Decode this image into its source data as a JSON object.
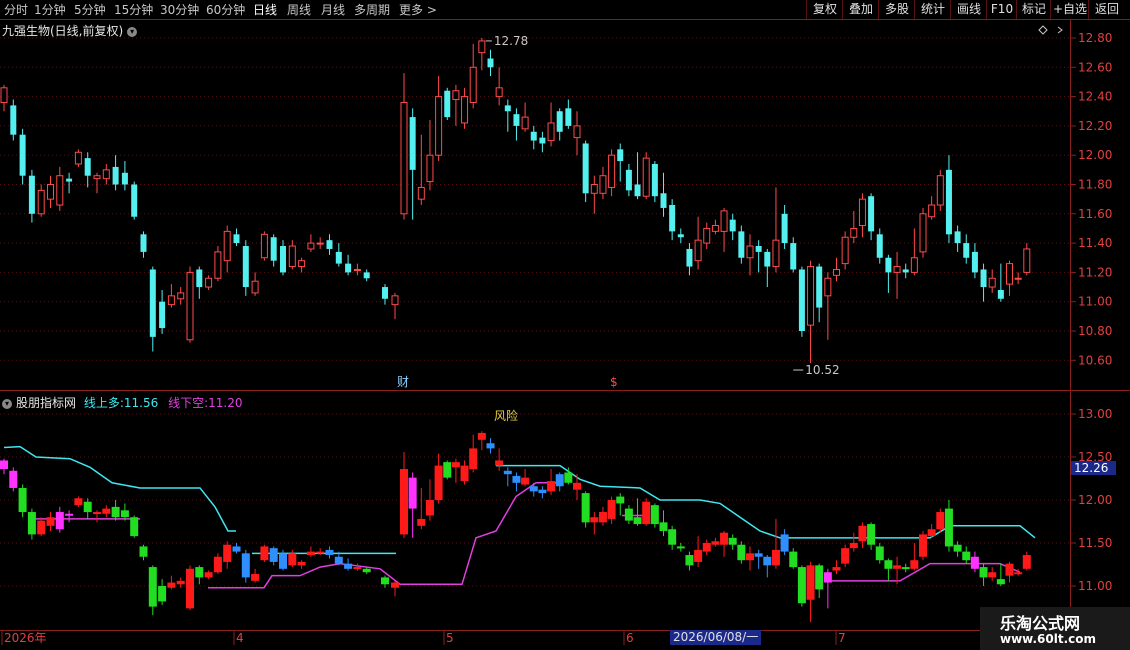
{
  "toolbar": {
    "tabs": [
      "分时",
      "1分钟",
      "5分钟",
      "15分钟",
      "30分钟",
      "60分钟",
      "日线",
      "周线",
      "月线",
      "多周期",
      "更多 >"
    ],
    "active_tab": "日线",
    "right_buttons": [
      "复权",
      "叠加",
      "多股",
      "统计",
      "画线",
      "F10",
      "标记",
      "+自选",
      "返回"
    ]
  },
  "main_chart": {
    "title": "九强生物(日线,前复权)",
    "high_label": "12.78",
    "low_label": "10.52",
    "markers": [
      "财",
      "$"
    ],
    "price_axis": [
      "12.80",
      "12.60",
      "12.40",
      "12.20",
      "12.00",
      "11.80",
      "11.60",
      "11.40",
      "11.20",
      "11.00",
      "10.80",
      "10.60"
    ]
  },
  "indicator": {
    "name": "股朋指标网",
    "line_up_label": "线上多:",
    "line_up_value": "11.56",
    "line_down_label": "线下空:",
    "line_down_value": "11.20",
    "risk_text": "风险",
    "axis": [
      "13.00",
      "12.50",
      "12.00",
      "11.50",
      "11.00"
    ],
    "current_value": "12.26"
  },
  "x_axis": {
    "labels": [
      "2026年",
      "4",
      "5",
      "6",
      "7"
    ],
    "highlight_date": "2026/06/08/一"
  },
  "watermark": {
    "line1": "乐淘公式网",
    "line2": "www.60lt.com"
  },
  "colors": {
    "up": "#ff4a4a",
    "down": "#54f0f0",
    "ind_up": "#ff1a1a",
    "ind_down_green": "#22dd22",
    "ind_blue": "#2f8fff",
    "ind_magenta": "#ff33ff",
    "cyan_line": "#3ee8f0",
    "magenta_line": "#e040e0",
    "frame": "#8a1f1f"
  }
}
